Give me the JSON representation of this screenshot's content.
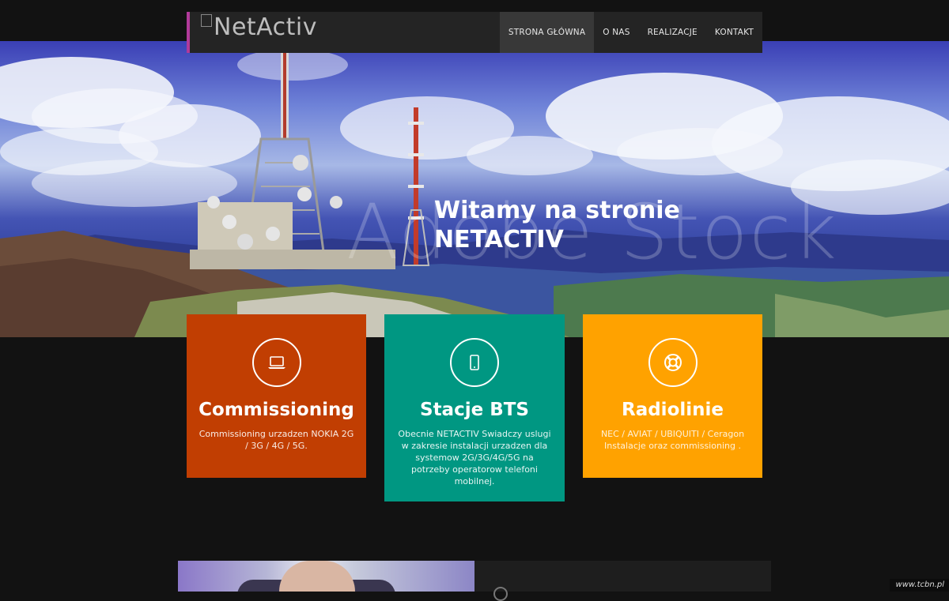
{
  "header": {
    "logo_text": "NetActiv",
    "nav": [
      {
        "label": "STRONA GŁÓWNA",
        "active": true
      },
      {
        "label": "O NAS",
        "active": false
      },
      {
        "label": "REALIZACJE",
        "active": false
      },
      {
        "label": "KONTAKT",
        "active": false
      }
    ]
  },
  "hero": {
    "title_line1": "Witamy na stronie",
    "title_line2": "NETACTIV",
    "watermark": "Adobe Stock"
  },
  "cards": [
    {
      "title": "Commissioning",
      "text": "Commissioning urzadzen NOKIA 2G / 3G / 4G / 5G.",
      "icon": "laptop-icon",
      "color": "#c13e02"
    },
    {
      "title": "Stacje BTS",
      "text": "Obecnie NETACTIV Swiadczy uslugi w zakresie instalacji urzadzen dla systemow 2G/3G/4G/5G na potrzeby operatorow telefoni mobilnej.",
      "icon": "mobile-icon",
      "color": "#009782"
    },
    {
      "title": "Radiolinie",
      "text": "NEC / AVIAT / UBIQUITI / Ceragon Instalacje oraz commissioning .",
      "icon": "life-ring-icon",
      "color": "#ffa200"
    }
  ],
  "credit": "www.tcbn.pl",
  "accent": "#b13a9a"
}
